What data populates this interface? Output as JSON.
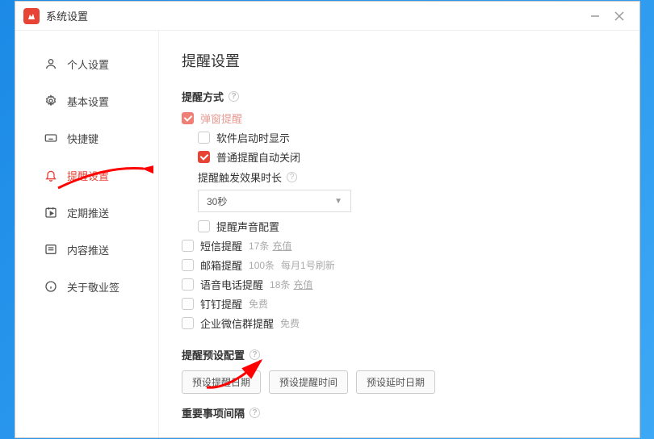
{
  "window": {
    "title": "系统设置"
  },
  "sidebar": {
    "items": [
      {
        "label": "个人设置",
        "icon": "user-icon"
      },
      {
        "label": "基本设置",
        "icon": "gear-icon"
      },
      {
        "label": "快捷键",
        "icon": "keyboard-icon"
      },
      {
        "label": "提醒设置",
        "icon": "bell-icon"
      },
      {
        "label": "定期推送",
        "icon": "schedule-icon"
      },
      {
        "label": "内容推送",
        "icon": "push-icon"
      },
      {
        "label": "关于敬业签",
        "icon": "info-icon"
      }
    ],
    "active_index": 3
  },
  "page": {
    "title": "提醒设置"
  },
  "reminder_method": {
    "section": "提醒方式",
    "popup": {
      "label": "弹窗提醒",
      "checked": true,
      "locked": true
    },
    "show_on_startup": {
      "label": "软件启动时显示",
      "checked": false
    },
    "auto_close_normal": {
      "label": "普通提醒自动关闭",
      "checked": true
    },
    "trigger_duration": {
      "label": "提醒触发效果时长",
      "selected": "30秒"
    },
    "sound_config": {
      "label": "提醒声音配置",
      "checked": false
    },
    "sms": {
      "label": "短信提醒",
      "checked": false,
      "meta": "17条",
      "action": "充值"
    },
    "email": {
      "label": "邮箱提醒",
      "checked": false,
      "meta": "100条",
      "extra": "每月1号刷新"
    },
    "voice": {
      "label": "语音电话提醒",
      "checked": false,
      "meta": "18条",
      "action": "充值"
    },
    "dingtalk": {
      "label": "钉钉提醒",
      "checked": false,
      "meta": "免费"
    },
    "wework": {
      "label": "企业微信群提醒",
      "checked": false,
      "meta": "免费"
    }
  },
  "preset": {
    "section": "提醒预设配置",
    "buttons": [
      "预设提醒日期",
      "预设提醒时间",
      "预设延时日期"
    ]
  },
  "important": {
    "section": "重要事项间隔"
  }
}
